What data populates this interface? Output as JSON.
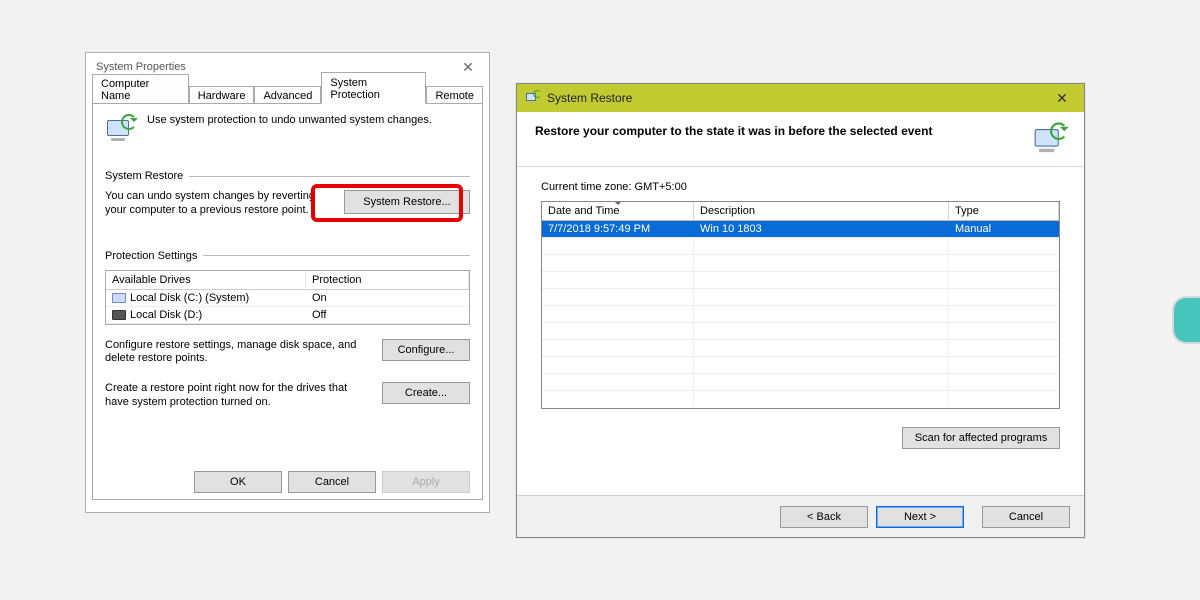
{
  "sysprop": {
    "title": "System Properties",
    "tabs": [
      "Computer Name",
      "Hardware",
      "Advanced",
      "System Protection",
      "Remote"
    ],
    "active_tab_index": 3,
    "intro_text": "Use system protection to undo unwanted system changes.",
    "section_restore": {
      "label": "System Restore",
      "text": "You can undo system changes by reverting your computer to a previous restore point.",
      "button": "System Restore..."
    },
    "section_protection": {
      "label": "Protection Settings",
      "columns": [
        "Available Drives",
        "Protection"
      ],
      "rows": [
        {
          "drive": "Local Disk (C:) (System)",
          "protection": "On",
          "icon": "drive-icon-c"
        },
        {
          "drive": "Local Disk (D:)",
          "protection": "Off",
          "icon": "drive-icon-d"
        }
      ],
      "configure_text": "Configure restore settings, manage disk space, and delete restore points.",
      "configure_button": "Configure...",
      "create_text": "Create a restore point right now for the drives that have system protection turned on.",
      "create_button": "Create..."
    },
    "buttons": {
      "ok": "OK",
      "cancel": "Cancel",
      "apply": "Apply"
    }
  },
  "wizard": {
    "title": "System Restore",
    "heading": "Restore your computer to the state it was in before the selected event",
    "timezone": "Current time zone: GMT+5:00",
    "columns": [
      "Date and Time",
      "Description",
      "Type"
    ],
    "rows": [
      {
        "datetime": "7/7/2018 9:57:49 PM",
        "description": "Win 10 1803",
        "type": "Manual",
        "selected": true
      }
    ],
    "scan_button": "Scan for affected programs",
    "back": "< Back",
    "next": "Next >",
    "cancel": "Cancel"
  }
}
